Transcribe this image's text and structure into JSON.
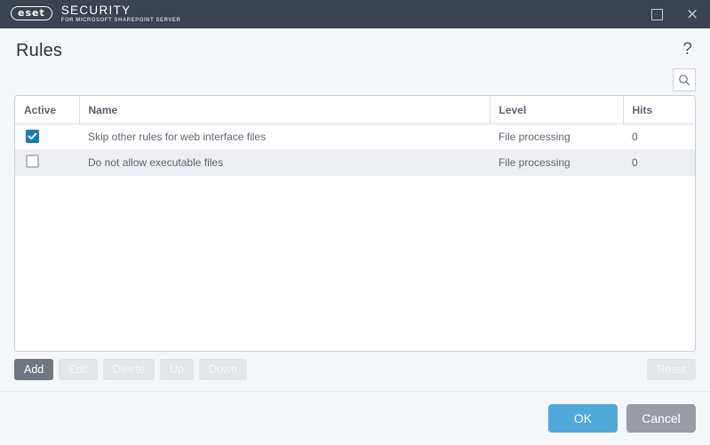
{
  "titlebar": {
    "brand_mark": "eset",
    "brand_line1": "SECURITY",
    "brand_line2": "FOR MICROSOFT SHAREPOINT SERVER",
    "maximize_label": "",
    "close_label": "×"
  },
  "header": {
    "title": "Rules",
    "help_label": "?"
  },
  "search": {
    "icon": "search-icon"
  },
  "table": {
    "columns": [
      {
        "key": "active",
        "label": "Active"
      },
      {
        "key": "name",
        "label": "Name"
      },
      {
        "key": "level",
        "label": "Level"
      },
      {
        "key": "hits",
        "label": "Hits"
      }
    ],
    "rows": [
      {
        "active": true,
        "name": "Skip other rules for web interface files",
        "level": "File processing",
        "hits": "0"
      },
      {
        "active": false,
        "name": "Do not allow executable files",
        "level": "File processing",
        "hits": "0"
      }
    ]
  },
  "actions": {
    "add": "Add",
    "edit": "Edit",
    "delete": "Delete",
    "up": "Up",
    "down": "Down",
    "reset": "Reset"
  },
  "footer": {
    "ok": "OK",
    "cancel": "Cancel"
  },
  "colors": {
    "titlebar_bg": "#3c4350",
    "accent_blue": "#51a8db",
    "checkbox_blue": "#1b7cb5",
    "button_grey": "#6f7680",
    "cancel_grey": "#989ca3",
    "page_bg": "#f4f6f8",
    "row_alt_bg": "#eceef1"
  }
}
